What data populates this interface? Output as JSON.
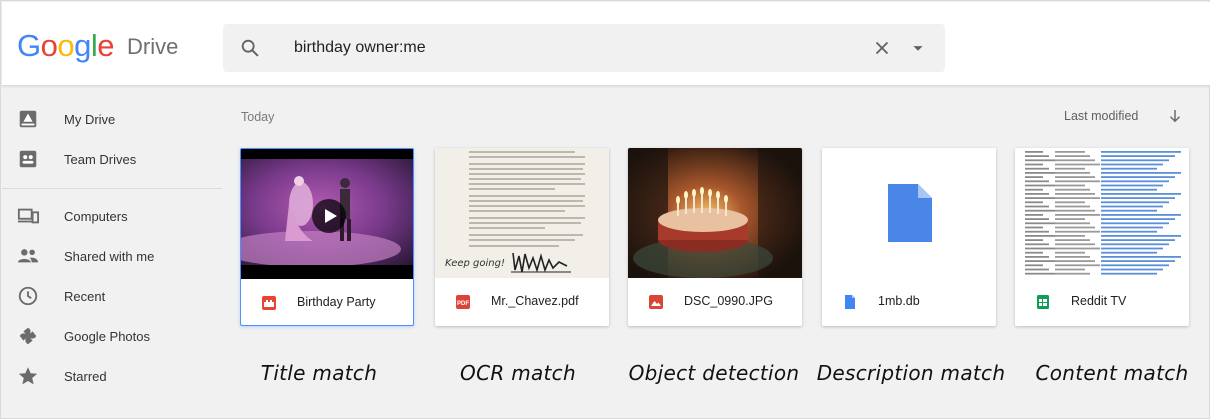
{
  "app": {
    "logo_letters": [
      "G",
      "o",
      "o",
      "g",
      "l",
      "e"
    ],
    "logo_colors": [
      "#4285F4",
      "#EA4335",
      "#FBBC05",
      "#4285F4",
      "#34A853",
      "#EA4335"
    ],
    "product": "Drive"
  },
  "search": {
    "query": "birthday owner:me"
  },
  "sidebar": {
    "items": [
      {
        "label": "My Drive",
        "icon": "my-drive-icon"
      },
      {
        "label": "Team Drives",
        "icon": "team-drives-icon"
      },
      {
        "label": "Computers",
        "icon": "computers-icon"
      },
      {
        "label": "Shared with me",
        "icon": "shared-icon"
      },
      {
        "label": "Recent",
        "icon": "clock-icon"
      },
      {
        "label": "Google Photos",
        "icon": "photos-icon"
      },
      {
        "label": "Starred",
        "icon": "star-icon"
      }
    ]
  },
  "main": {
    "section": "Today",
    "sort_label": "Last modified",
    "files": [
      {
        "name": "Birthday Party",
        "type": "video",
        "icon": "video-file-icon",
        "icon_color": "#EA4335"
      },
      {
        "name": "Mr._Chavez.pdf",
        "type": "pdf",
        "icon": "pdf-file-icon",
        "icon_color": "#DB4437"
      },
      {
        "name": "DSC_0990.JPG",
        "type": "image",
        "icon": "image-file-icon",
        "icon_color": "#DB4437"
      },
      {
        "name": "1mb.db",
        "type": "generic",
        "icon": "generic-file-icon",
        "icon_color": "#4285F4"
      },
      {
        "name": "Reddit TV",
        "type": "sheet",
        "icon": "sheet-file-icon",
        "icon_color": "#0F9D58"
      }
    ],
    "handwritten_signature": "Keep going!"
  },
  "captions": [
    "Title match",
    "OCR match",
    "Object detection",
    "Description match",
    "Content match"
  ],
  "colors": {
    "accent": "#4285F4",
    "selected_border": "#4d90fe"
  }
}
